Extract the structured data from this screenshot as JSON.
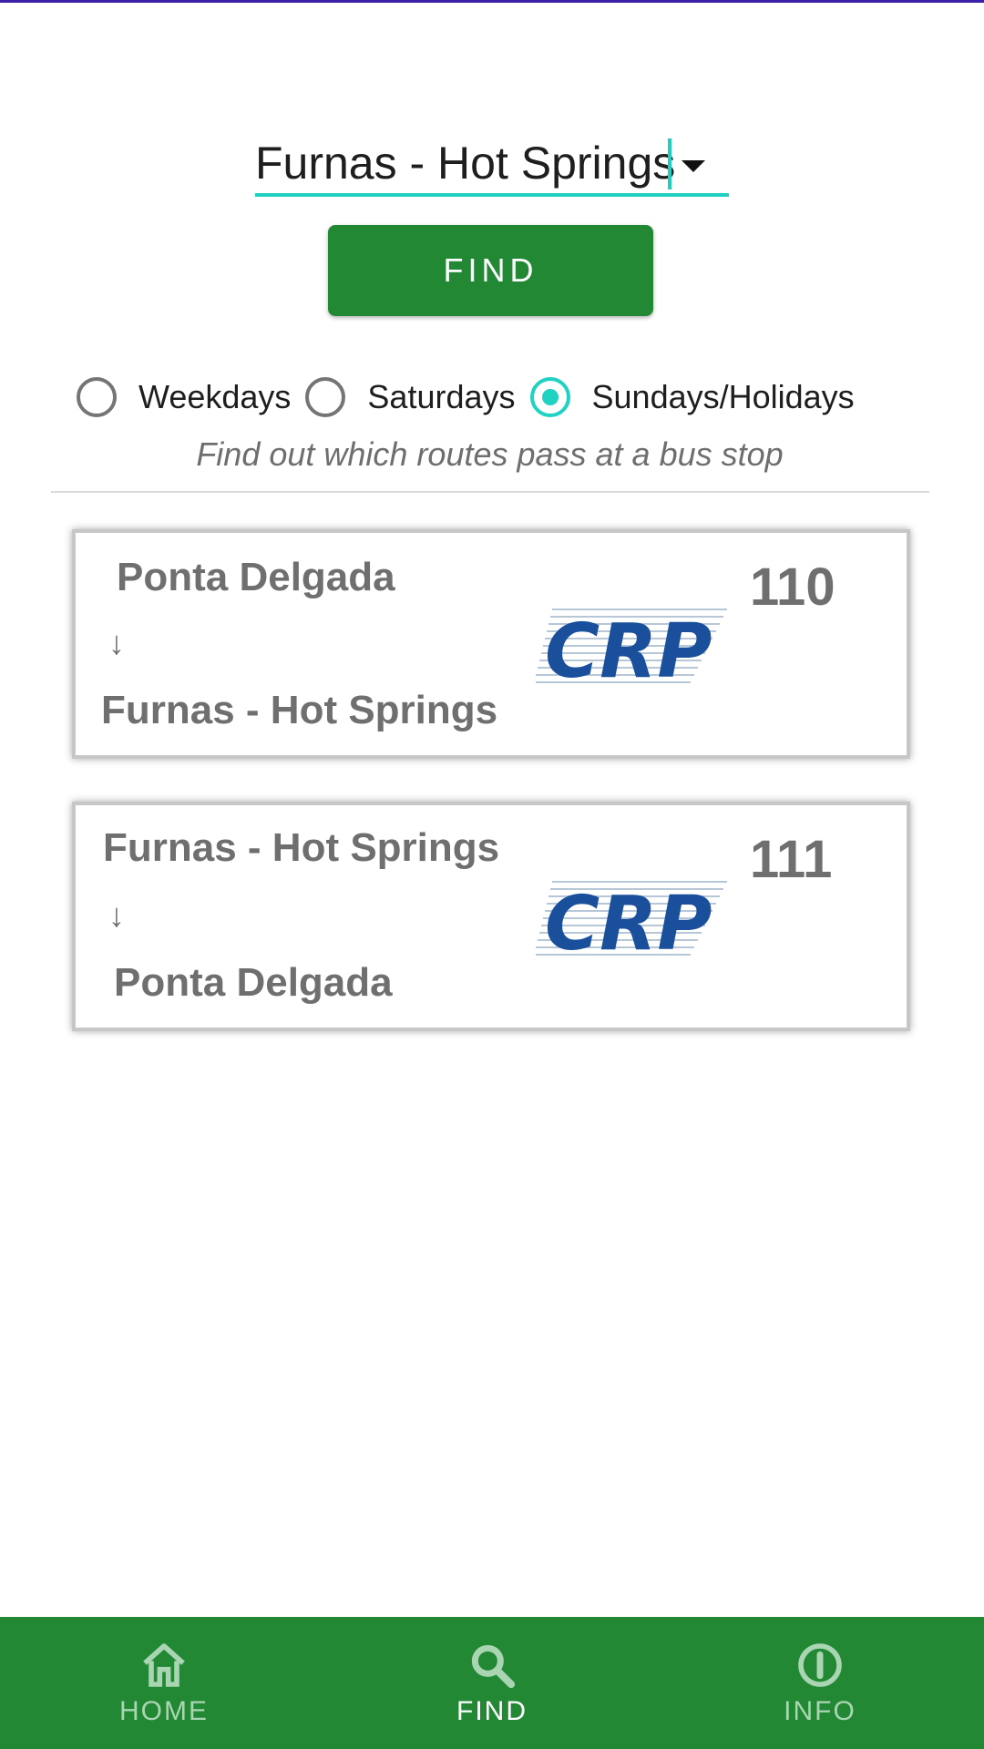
{
  "search": {
    "selected_stop": "Furnas - Hot Springs",
    "find_label": "FIND"
  },
  "schedule": {
    "options": [
      {
        "label": "Weekdays",
        "checked": false
      },
      {
        "label": "Saturdays",
        "checked": false
      },
      {
        "label": "Sundays/Holidays",
        "checked": true
      }
    ],
    "hint": "Find out which routes pass at a bus stop"
  },
  "routes": [
    {
      "origin": "Ponta Delgada",
      "arrow": "↓",
      "destination": "Furnas - Hot Springs",
      "number": "110",
      "operator": "CRP"
    },
    {
      "origin": "Furnas - Hot Springs",
      "arrow": "↓",
      "destination": "Ponta Delgada",
      "number": "111",
      "operator": "CRP"
    }
  ],
  "nav": {
    "items": [
      {
        "label": "HOME",
        "icon": "home-icon",
        "active": false
      },
      {
        "label": "FIND",
        "icon": "search-icon",
        "active": true
      },
      {
        "label": "INFO",
        "icon": "info-icon",
        "active": false
      }
    ]
  },
  "colors": {
    "primary_green": "#228833",
    "accent_teal": "#1fd2c2",
    "logo_blue": "#1a4f9c"
  }
}
